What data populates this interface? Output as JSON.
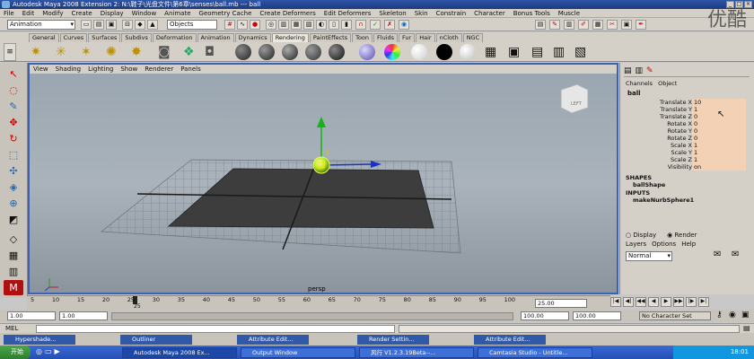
{
  "window": {
    "title": "Autodesk Maya 2008 Extension 2: N:\\鞋子\\光盘文件\\第6章\\senses\\ball.mb  ---  ball",
    "watermark": "优酷"
  },
  "menus": [
    "File",
    "Edit",
    "Modify",
    "Create",
    "Display",
    "Window",
    "Animate",
    "Geometry Cache",
    "Create Deformers",
    "Edit Deformers",
    "Skeleton",
    "Skin",
    "Constrain",
    "Character",
    "Bonus Tools",
    "Muscle"
  ],
  "status_line": {
    "mode": "Animation",
    "objects_field": "Objects"
  },
  "shelf_tabs": [
    "General",
    "Curves",
    "Surfaces",
    "Subdivs",
    "Deformation",
    "Animation",
    "Dynamics",
    "Rendering",
    "PaintEffects",
    "Toon",
    "Fluids",
    "Fur",
    "Hair",
    "nCloth",
    "NGC"
  ],
  "active_shelf_tab": "Rendering",
  "panel_menu": [
    "View",
    "Shading",
    "Lighting",
    "Show",
    "Renderer",
    "Panels"
  ],
  "viewport": {
    "camera": "persp",
    "view_cube": "LEFT"
  },
  "channel_box": {
    "tabs": [
      "Channels",
      "Object"
    ],
    "object_name": "ball",
    "attributes": [
      {
        "name": "Translate X",
        "value": "10"
      },
      {
        "name": "Translate Y",
        "value": "1"
      },
      {
        "name": "Translate Z",
        "value": "0"
      },
      {
        "name": "Rotate X",
        "value": "0"
      },
      {
        "name": "Rotate Y",
        "value": "0"
      },
      {
        "name": "Rotate Z",
        "value": "0"
      },
      {
        "name": "Scale X",
        "value": "1"
      },
      {
        "name": "Scale Y",
        "value": "1"
      },
      {
        "name": "Scale Z",
        "value": "1"
      },
      {
        "name": "Visibility",
        "value": "on"
      }
    ],
    "shapes_header": "SHAPES",
    "shape_name": "ballShape",
    "inputs_header": "INPUTS",
    "input_name": "makeNurbSphere1"
  },
  "layer_editor": {
    "display_label": "Display",
    "render_label": "Render",
    "menus": [
      "Layers",
      "Options",
      "Help"
    ],
    "layer_select": "Normal"
  },
  "time_slider": {
    "ticks": [
      "5",
      "10",
      "15",
      "20",
      "25",
      "30",
      "35",
      "40",
      "45",
      "50",
      "55",
      "60",
      "65",
      "70",
      "75",
      "80",
      "85",
      "90",
      "95",
      "100"
    ],
    "current_frame": "25.00",
    "current_marker": "25"
  },
  "range_slider": {
    "start": "1.00",
    "playback_start": "1.00",
    "playback_end": "100.00",
    "end": "100.00",
    "character_set": "No Character Set"
  },
  "command_line": {
    "label": "MEL"
  },
  "minimized_windows": [
    "Hypershade...",
    "Outliner",
    "Attribute Edit...",
    "Render Settin...",
    "Attribute Edit..."
  ],
  "taskbar": {
    "start": "开始",
    "tasks": [
      "Autodesk Maya 2008 Ex...",
      "Output Window",
      "风行 V1.2.3.19Beta--...",
      "Camtasia Studio - Untitle..."
    ],
    "clock": "18:01"
  }
}
